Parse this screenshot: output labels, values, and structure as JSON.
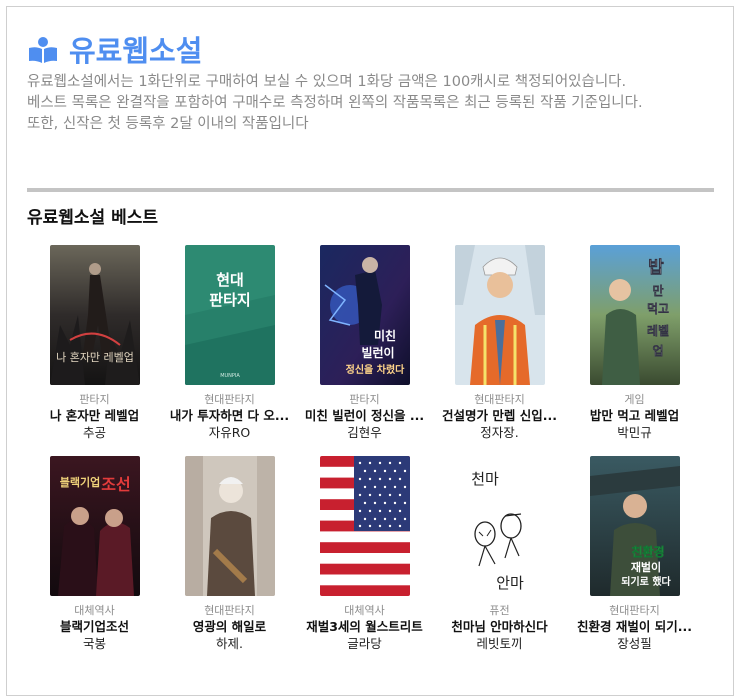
{
  "header": {
    "icon": "open-book-icon",
    "accent": "#4f8ef0",
    "title": "유료웹소설",
    "desc": [
      "유료웹소설에서는 1화단위로 구매하여 보실 수 있으며 1화당 금액은 100캐시로 책정되어있습니다.",
      "베스트 목록은 완결작을 포함하여 구매수로 측정하며 왼쪽의 작품목록은 최근 등록된 작품 기준입니다.",
      "또한, 신작은 첫 등록후 2달 이내의 작품입니다"
    ]
  },
  "best": {
    "title": "유료웹소설 베스트",
    "items": [
      {
        "genre": "판타지",
        "title": "나 혼자만 레벨업",
        "author": "추공",
        "cover": "dark-fantasy-cover",
        "cover_text": "나 혼자만 레벨업"
      },
      {
        "genre": "현대판타지",
        "title": "내가 투자하면 다 오...",
        "author": "자유RO",
        "cover": "green-cover",
        "cover_text": "현대 판타지"
      },
      {
        "genre": "판타지",
        "title": "미친 빌런이 정신을 ...",
        "author": "김현우",
        "cover": "blue-villain-cover",
        "cover_text": "미친 빌런이 정신을 차렸다"
      },
      {
        "genre": "현대판타지",
        "title": "건설명가 만렙 신입...",
        "author": "정자장.",
        "cover": "construction-worker-cover",
        "cover_text": ""
      },
      {
        "genre": "게임",
        "title": "밥만 먹고 레벨업",
        "author": "박민규",
        "cover": "game-cover",
        "cover_text": "밥만 먹고 레벨업"
      },
      {
        "genre": "대체역사",
        "title": "블랙기업조선",
        "author": "국봉",
        "cover": "black-company-cover",
        "cover_text": "블랙기업 조선"
      },
      {
        "genre": "현대판타지",
        "title": "영광의 해일로",
        "author": "하제.",
        "cover": "street-cover",
        "cover_text": ""
      },
      {
        "genre": "대체역사",
        "title": "재벌3세의 월스트리트",
        "author": "글라당",
        "cover": "us-flag-cover",
        "cover_text": ""
      },
      {
        "genre": "퓨전",
        "title": "천마님 안마하신다",
        "author": "레빗토끼",
        "cover": "sketch-cover",
        "cover_text": "천마 안마"
      },
      {
        "genre": "현대판타지",
        "title": "친환경 재벌이 되기...",
        "author": "장성필",
        "cover": "eco-cover",
        "cover_text": "친환경 재벌이 되기로 했다"
      }
    ]
  }
}
